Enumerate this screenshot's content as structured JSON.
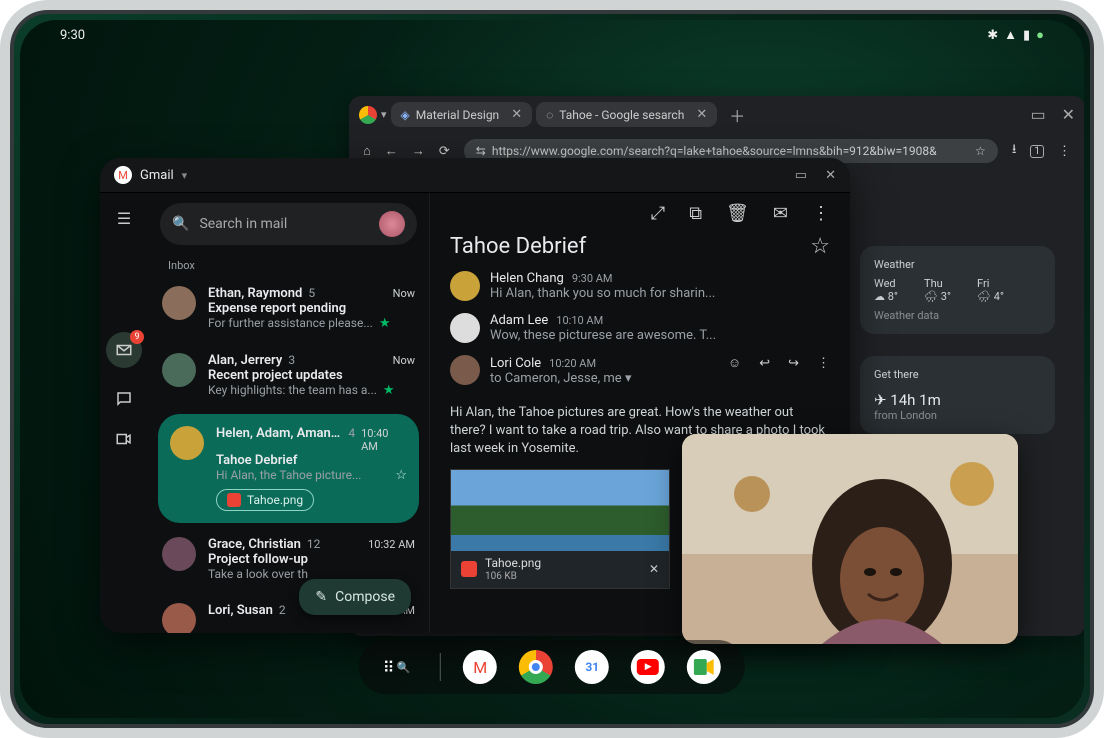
{
  "status": {
    "time": "9:30"
  },
  "browser": {
    "tabs": [
      {
        "label": "Material Design"
      },
      {
        "label": "Tahoe - Google sesarch"
      }
    ],
    "url": "https://www.google.com/search?q=lake+tahoe&source=lmns&bih=912&biw=1908&"
  },
  "weather": {
    "title": "Weather",
    "days": [
      {
        "label": "Wed",
        "temp": "8°"
      },
      {
        "label": "Thu",
        "temp": "3°"
      },
      {
        "label": "Fri",
        "temp": "4°"
      }
    ],
    "footer": "Weather data"
  },
  "map": {
    "title": "Get there",
    "duration": "14h 1m",
    "from": "from London"
  },
  "gmail": {
    "app_label": "Gmail",
    "search_placeholder": "Search in mail",
    "section": "Inbox",
    "compose": "Compose",
    "threads": [
      {
        "senders": "Ethan, Raymond",
        "count": "5",
        "time": "Now",
        "subject": "Expense report pending",
        "snippet": "For further assistance please...",
        "starred": true
      },
      {
        "senders": "Alan, Jerrery",
        "count": "3",
        "time": "Now",
        "subject": "Recent project updates",
        "snippet": "Key highlights: the team has a...",
        "starred": true
      },
      {
        "senders": "Helen, Adam, Amanda",
        "count": "4",
        "time": "10:40 AM",
        "subject": "Tahoe Debrief",
        "snippet": "Hi Alan, the Tahoe picture...",
        "chip": "Tahoe.png",
        "selected": true
      },
      {
        "senders": "Grace, Christian",
        "count": "12",
        "time": "10:32 AM",
        "subject": "Project follow-up",
        "snippet": "Take a look over th"
      },
      {
        "senders": "Lori, Susan",
        "count": "2",
        "time": "8:22 AM",
        "subject": "",
        "snippet": ""
      }
    ]
  },
  "reader": {
    "subject": "Tahoe Debrief",
    "messages": [
      {
        "sender": "Helen Chang",
        "time": "9:30 AM",
        "body": "Hi Alan, thank you so much for sharin..."
      },
      {
        "sender": "Adam Lee",
        "time": "10:10 AM",
        "body": "Wow, these picturese are awesome. T..."
      },
      {
        "sender": "Lori Cole",
        "time": "10:20 AM",
        "recipients": "to Cameron, Jesse, me"
      }
    ],
    "body": "Hi Alan, the Tahoe pictures are great. How's the weather out there? I want to take a road trip. Also want to share a photo I took last week in Yosemite.",
    "attachment": {
      "name": "Tahoe.png",
      "size": "106 KB"
    }
  }
}
